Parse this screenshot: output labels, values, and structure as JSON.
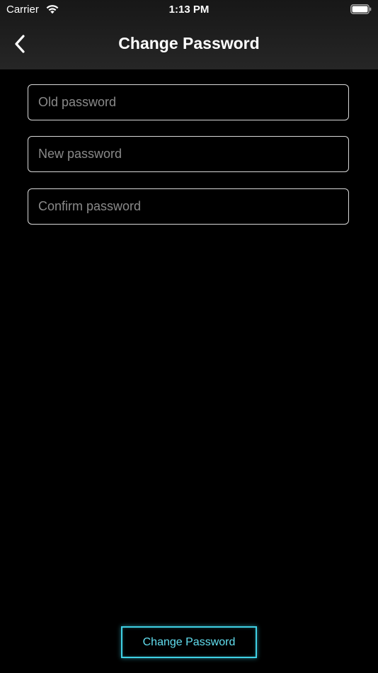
{
  "status_bar": {
    "carrier": "Carrier",
    "time": "1:13 PM",
    "wifi_icon": "wifi-icon",
    "battery_icon": "battery-full-icon"
  },
  "nav": {
    "back_icon": "chevron-left-icon",
    "title": "Change Password"
  },
  "form": {
    "old_password": {
      "placeholder": "Old password",
      "value": ""
    },
    "new_password": {
      "placeholder": "New password",
      "value": ""
    },
    "confirm_password": {
      "placeholder": "Confirm password",
      "value": ""
    }
  },
  "actions": {
    "submit_label": "Change Password"
  },
  "colors": {
    "background": "#000000",
    "header": "#1f1f1f",
    "field_border": "#d8d8d8",
    "placeholder": "#8a8a8a",
    "accent": "#3fd0e4"
  }
}
